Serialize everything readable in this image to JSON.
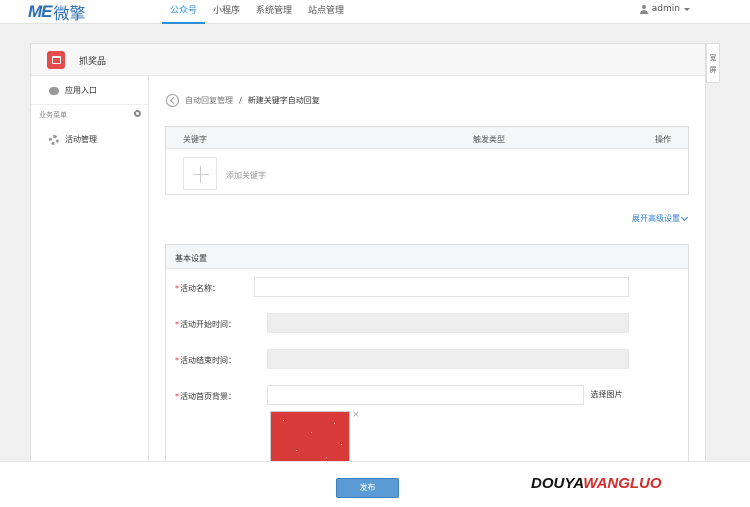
{
  "brand": {
    "logo_text": "ME",
    "logo_cn": "微擎"
  },
  "nav": {
    "items": [
      {
        "label": "公众号",
        "active": true
      },
      {
        "label": "小程序",
        "active": false
      },
      {
        "label": "系统管理",
        "active": false
      },
      {
        "label": "站点管理",
        "active": false
      }
    ]
  },
  "user": {
    "name": "admin"
  },
  "module": {
    "name": "抓奖品"
  },
  "sidebar": {
    "entry_label": "应用入口",
    "group_label": "业务菜单",
    "menu_label": "活动管理"
  },
  "widescreen_label": "宽屏",
  "breadcrumb": {
    "parent": "自动回复管理",
    "separator": "/",
    "current": "新建关键字自动回复"
  },
  "keywords": {
    "columns": [
      "关键字",
      "触发类型",
      "操作"
    ],
    "add_label": "添加关键字"
  },
  "advanced_label": "展开高级设置",
  "basic": {
    "title": "基本设置",
    "fields": [
      {
        "label": "活动名称：",
        "required": true,
        "value": ""
      },
      {
        "label": "活动开始时间：",
        "required": true,
        "value": ""
      },
      {
        "label": "活动结束时间：",
        "required": true,
        "value": ""
      },
      {
        "label": "活动首页背景：",
        "required": true,
        "value": ""
      }
    ],
    "pick_image_label": "选择图片",
    "remove_label": "×"
  },
  "footer": {
    "publish_label": "发布"
  },
  "watermark": {
    "part1": "DOUYA",
    "part2": "WANGLUO"
  },
  "colors": {
    "accent": "#2f8fd8",
    "publish": "#5b9bd5",
    "module_icon": "#e74c4c",
    "thumb": "#d93a3a"
  }
}
